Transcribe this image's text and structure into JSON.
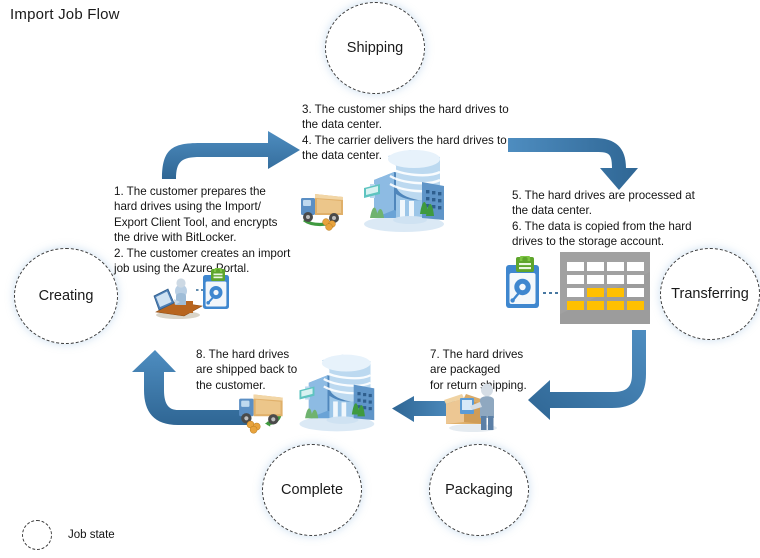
{
  "title": "Import Job Flow",
  "states": [
    {
      "id": "shipping",
      "label": "Shipping"
    },
    {
      "id": "transferring",
      "label": "Transferring"
    },
    {
      "id": "packaging",
      "label": "Packaging"
    },
    {
      "id": "complete",
      "label": "Complete"
    },
    {
      "id": "creating",
      "label": "Creating"
    }
  ],
  "steps": [
    {
      "id": "step-1-2",
      "lines": [
        "1. The customer prepares the",
        "hard drives using the Import/",
        "Export Client Tool, and encrypts",
        "the drive with BitLocker.",
        "2. The customer creates an import",
        "job using the Azure Portal."
      ]
    },
    {
      "id": "step-3-4",
      "lines": [
        "3. The customer ships the hard drives to",
        "the data center.",
        "4. The carrier delivers the hard drives to",
        "the data center."
      ]
    },
    {
      "id": "step-5-6",
      "lines": [
        "5. The hard drives are processed at",
        "the data center.",
        "6. The data is copied from the hard",
        "drives to the storage account."
      ]
    },
    {
      "id": "step-7",
      "lines": [
        "7. The hard drives",
        "are packaged",
        "for return shipping."
      ]
    },
    {
      "id": "step-8",
      "lines": [
        "8. The hard drives",
        "are shipped back to",
        "the customer."
      ]
    }
  ],
  "legend": {
    "label": "Job state",
    "icon": "dashed-circle-icon"
  },
  "icons": [
    {
      "id": "customer-workstation-icon",
      "name": "person-at-computer-icon"
    },
    {
      "id": "encrypted-drive-icon",
      "name": "hard-drive-with-lock-icon"
    },
    {
      "id": "shipping-truck-icon",
      "name": "delivery-truck-icon"
    },
    {
      "id": "datacenter-icon",
      "name": "data-center-building-icon"
    },
    {
      "id": "processed-drive-icon",
      "name": "hard-drive-with-lock-icon"
    },
    {
      "id": "storage-account-icon",
      "name": "storage-table-icon"
    },
    {
      "id": "packaging-person-icon",
      "name": "person-packing-box-icon"
    },
    {
      "id": "return-datacenter-icon",
      "name": "data-center-building-icon"
    },
    {
      "id": "return-truck-icon",
      "name": "delivery-truck-icon"
    }
  ],
  "arrows": [
    {
      "id": "arrow-creating-to-shipping",
      "direction": "right"
    },
    {
      "id": "arrow-shipping-to-transferring",
      "direction": "down"
    },
    {
      "id": "arrow-transferring-to-packaging",
      "direction": "left"
    },
    {
      "id": "arrow-packaging-to-complete",
      "direction": "left"
    },
    {
      "id": "arrow-complete-to-creating",
      "direction": "up"
    }
  ],
  "colors": {
    "arrow": "#3d7ab0",
    "arrow_dark": "#2f6694",
    "state_border": "#3b3b3b",
    "glow": "#7aaad7",
    "text": "#141414",
    "storage_table": "#9c9c9c",
    "storage_highlight": "#ffc000",
    "lock_green": "#5ea52c",
    "drive_blue": "#3f87cf"
  }
}
